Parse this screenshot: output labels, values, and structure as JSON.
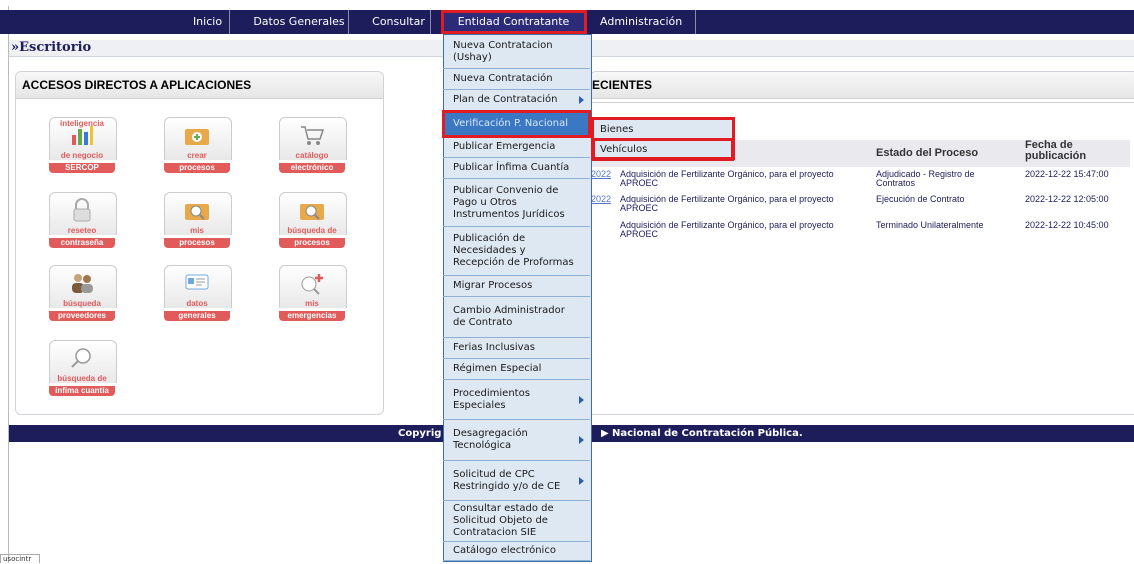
{
  "nav": {
    "items": [
      "Inicio",
      "Datos Generales",
      "Consultar",
      "Entidad Contratante",
      "Administración"
    ]
  },
  "escritorio": {
    "title": "»Escritorio"
  },
  "accesos": {
    "title": "ACCESOS DIRECTOS A APLICACIONES",
    "tiles": [
      {
        "top": "inteligencia",
        "line1": "de negocio",
        "line2": "SERCOP",
        "icon": "bar-chart-icon"
      },
      {
        "top": "",
        "line1": "crear",
        "line2": "procesos",
        "icon": "folder-plus-icon"
      },
      {
        "top": "",
        "line1": "catálogo",
        "line2": "electrónico",
        "icon": "shopping-cart-icon"
      },
      {
        "top": "",
        "line1": "reseteo",
        "line2": "contraseña",
        "icon": "padlock-icon"
      },
      {
        "top": "",
        "line1": "mis",
        "line2": "procesos",
        "icon": "folder-search-icon"
      },
      {
        "top": "",
        "line1": "búsqueda de",
        "line2": "procesos",
        "icon": "folder-search-icon"
      },
      {
        "top": "",
        "line1": "búsqueda",
        "line2": "proveedores",
        "icon": "people-icon"
      },
      {
        "top": "",
        "line1": "datos",
        "line2": "generales",
        "icon": "id-card-icon"
      },
      {
        "top": "",
        "line1": "mis",
        "line2": "emergencias",
        "icon": "emergency-search-icon"
      },
      {
        "top": "",
        "line1": "búsqueda de",
        "line2": "ínfima cuantía",
        "icon": "magnifier-icon"
      }
    ]
  },
  "recientes": {
    "title_fragment": "ECIENTES",
    "headers": {
      "estado": "Estado del Proceso",
      "fecha": "Fecha de publicación"
    },
    "rows": [
      {
        "code": "2022",
        "desc": "Adquisición de Fertilizante Orgánico, para el proyecto APROEC",
        "estado": "Adjudicado - Registro de Contratos",
        "fecha": "2022-12-22 15:47:00"
      },
      {
        "code": "2022",
        "desc": "Adquisición de Fertilizante Orgánico, para el proyecto APROEC",
        "estado": "Ejecución de Contrato",
        "fecha": "2022-12-22 12:05:00"
      },
      {
        "code": "",
        "desc": "Adquisición de Fertilizante Orgánico, para el proyecto APROEC",
        "estado": "Terminado Unilateralmente",
        "fecha": "2022-12-22 10:45:00"
      }
    ]
  },
  "footer": {
    "left": "Copyrig",
    "right": "Nacional de Contratación Pública."
  },
  "dropdown": {
    "items": [
      "Nueva Contratacion (Ushay)",
      "Nueva Contratación",
      "Plan de Contratación",
      "Verificación P. Nacional",
      "Publicar Emergencia",
      "Publicar Ínfima Cuantía",
      "Publicar Convenio de Pago u Otros Instrumentos Jurídicos",
      "Publicación de Necesidades y Recepción de Proformas",
      "Migrar Procesos",
      "Cambio Administrador de Contrato",
      "Ferias Inclusivas",
      "Régimen Especial",
      "Procedimientos Especiales",
      "Desagregación Tecnológica",
      "Solicitud de CPC Restringido y/o de CE",
      "Consultar estado de Solicitud Objeto de Contratacion SIE",
      "Catálogo electrónico"
    ]
  },
  "submenu": {
    "items": [
      "Bienes",
      "Vehículos"
    ]
  },
  "bottom_tag": "usocintr",
  "colors": {
    "navy": "#1d1d5c",
    "tile_red": "#e15b5b",
    "highlight_red": "#e01b22",
    "menu_bg": "#dde8f3",
    "menu_hl": "#3a78c4"
  }
}
